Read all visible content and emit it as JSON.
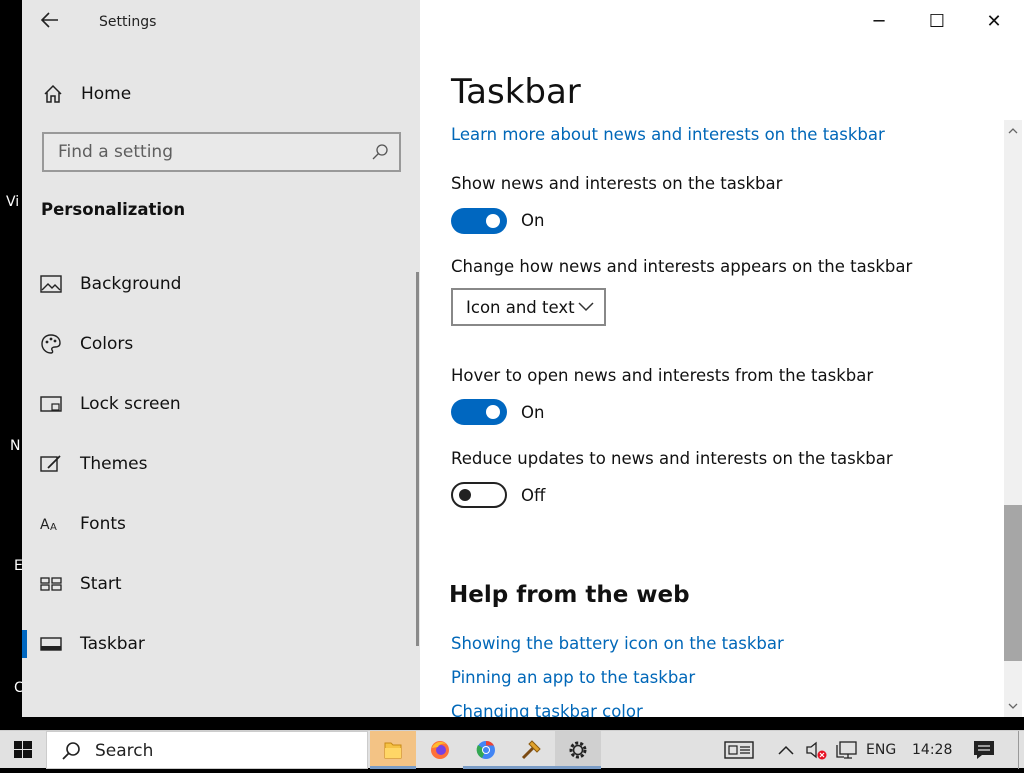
{
  "desktop": {
    "fragments": [
      "Vi",
      "N",
      "E",
      "C"
    ]
  },
  "window": {
    "title": "Settings",
    "controls": {
      "minimize": "─",
      "maximize": "☐",
      "close": "✕"
    }
  },
  "nav": {
    "home_label": "Home",
    "search_placeholder": "Find a setting",
    "section_title": "Personalization",
    "items": [
      {
        "label": "Background",
        "icon": "picture-icon",
        "selected": false
      },
      {
        "label": "Colors",
        "icon": "palette-icon",
        "selected": false
      },
      {
        "label": "Lock screen",
        "icon": "lock-screen-icon",
        "selected": false
      },
      {
        "label": "Themes",
        "icon": "themes-icon",
        "selected": false
      },
      {
        "label": "Fonts",
        "icon": "fonts-icon",
        "selected": false
      },
      {
        "label": "Start",
        "icon": "start-icon",
        "selected": false
      },
      {
        "label": "Taskbar",
        "icon": "taskbar-icon",
        "selected": true
      }
    ]
  },
  "content": {
    "page_title": "Taskbar",
    "learn_more_link": "Learn more about news and interests on the taskbar",
    "show_news": {
      "label": "Show news and interests on the taskbar",
      "state": "On"
    },
    "change_appearance": {
      "label": "Change how news and interests appears on the taskbar",
      "value": "Icon and text"
    },
    "hover_open": {
      "label": "Hover to open news and interests from the taskbar",
      "state": "On"
    },
    "reduce_updates": {
      "label": "Reduce updates to news and interests on the taskbar",
      "state": "Off"
    },
    "help_title": "Help from the web",
    "help_links": [
      "Showing the battery icon on the taskbar",
      "Pinning an app to the taskbar",
      "Changing taskbar color"
    ]
  },
  "taskbar": {
    "search_label": "Search",
    "apps": [
      "file-explorer-icon",
      "firefox-icon",
      "chrome-icon",
      "tool-app-icon",
      "settings-gear-icon"
    ],
    "language": "ENG",
    "time": "14:28"
  },
  "colors": {
    "accent": "#0067c0",
    "link": "#0067b8",
    "nav_bg": "#e6e6e6"
  }
}
